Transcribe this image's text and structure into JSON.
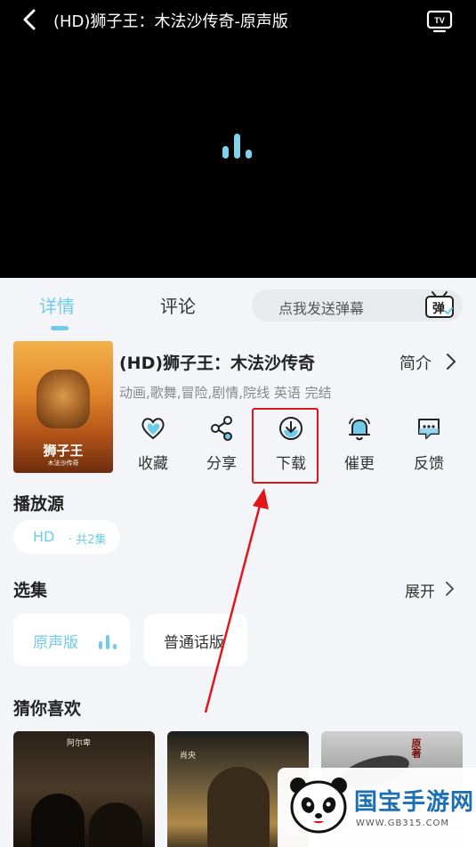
{
  "player": {
    "title": "(HD)狮子王：木法沙传奇-原声版",
    "back_icon": "chevron-left-icon",
    "tv_icon": "tv-cast-icon",
    "tv_label": "TV"
  },
  "tabs": [
    {
      "label": "详情",
      "active": true
    },
    {
      "label": "评论",
      "active": false
    }
  ],
  "danmu": {
    "placeholder": "点我发送弹幕",
    "icon_label": "弹"
  },
  "movie": {
    "poster_title": "狮子王",
    "poster_subtitle": "木法沙传奇",
    "title": "(HD)狮子王：木法沙传奇",
    "intro_label": "简介",
    "tags": "动画,歌舞,冒险,剧情,院线 英语 完结"
  },
  "actions": [
    {
      "label": "收藏",
      "icon": "heart-icon"
    },
    {
      "label": "分享",
      "icon": "share-icon"
    },
    {
      "label": "下载",
      "icon": "download-icon"
    },
    {
      "label": "催更",
      "icon": "bell-icon"
    },
    {
      "label": "反馈",
      "icon": "feedback-icon"
    }
  ],
  "source": {
    "section_title": "播放源",
    "name": "HD",
    "count": "· 共2集"
  },
  "episodes": {
    "section_title": "选集",
    "expand_label": "展开",
    "items": [
      {
        "label": "原声版",
        "active": true
      },
      {
        "label": "普通话版",
        "active": false
      }
    ]
  },
  "recommend": {
    "section_title": "猜你喜欢",
    "posters": [
      {
        "text": "阿尔卑"
      },
      {
        "text": "肖央"
      },
      {
        "text": "原著"
      }
    ]
  },
  "watermark": {
    "title": "国宝手游网",
    "url": "WWW.GB315.COM"
  },
  "colors": {
    "accent": "#6fcbe8",
    "highlight": "#e0161b",
    "watermark": "#1c6fb3"
  }
}
